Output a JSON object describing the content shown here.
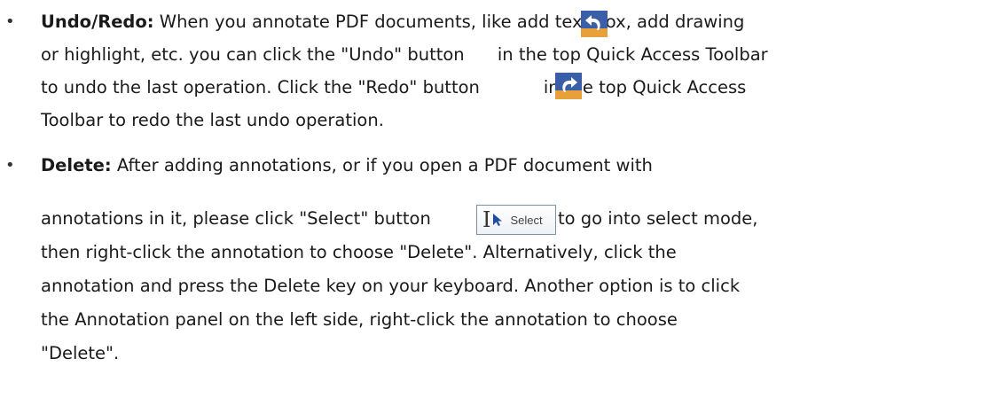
{
  "bullet_glyph": "•",
  "items": [
    {
      "title": "Undo/Redo:",
      "lines": [
        " When you annotate PDF documents, like add text box, add drawing",
        "or highlight, etc. you can click the \"Undo\" button",
        " in the top Quick Access Toolbar",
        "to undo the last operation. Click the \"Redo\" button",
        "in the top Quick Access",
        "Toolbar to redo the last undo operation."
      ]
    },
    {
      "title": "Delete:",
      "lines": [
        " After adding annotations, or if you open a PDF document with",
        "annotations in it, please click \"Select\" button",
        "to go into select mode,",
        "then right-click the annotation to choose \"Delete\". Alternatively, click the",
        "annotation and press the Delete key on your keyboard. Another option is to click",
        "the Annotation panel on the left side, right-click the annotation to choose",
        "\"Delete\"."
      ]
    }
  ],
  "icons": {
    "undo": "undo-icon",
    "redo": "redo-icon",
    "select": "select-tool-icon"
  },
  "select_button_label": "Select",
  "colors": {
    "icon_blue": "#3a5ea8",
    "icon_orange": "#e8a13a",
    "text": "#1a1a1a"
  }
}
